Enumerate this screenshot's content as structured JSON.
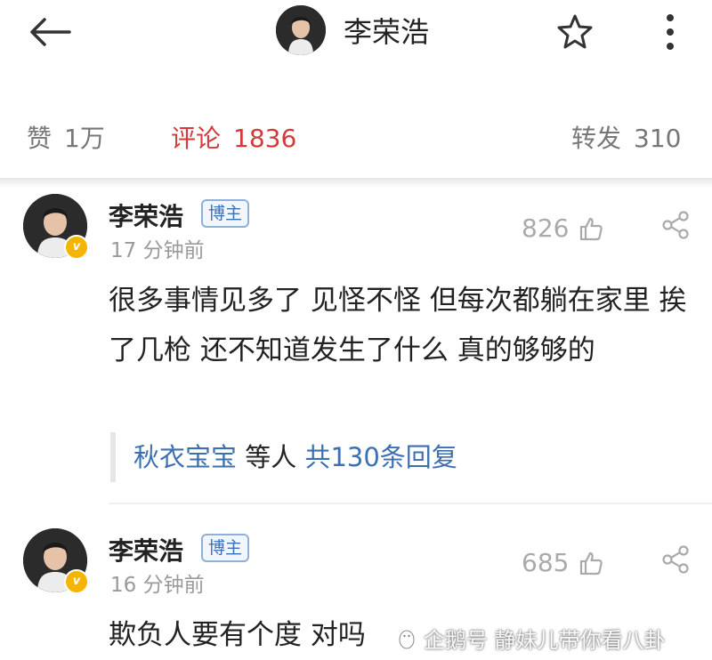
{
  "header": {
    "back_icon": "arrow-left-icon",
    "title": "李荣浩",
    "star_icon": "star-outline-icon",
    "more_icon": "more-vertical-icon"
  },
  "stats": {
    "likes_label": "赞",
    "likes_count": "1万",
    "comments_label": "评论",
    "comments_count": "1836",
    "reposts_label": "转发",
    "reposts_count": "310",
    "active_color": "#d43a3a"
  },
  "comments": [
    {
      "name": "李荣浩",
      "tag": "博主",
      "time": "17 分钟前",
      "likes": "826",
      "content": "很多事情见多了 见怪不怪 但每次都躺在家里 挨了几枪 还不知道发生了什么 真的够够的",
      "replies": {
        "user": "秋衣宝宝",
        "mid": " 等人 ",
        "total": "共130条回复"
      }
    },
    {
      "name": "李荣浩",
      "tag": "博主",
      "time": "16 分钟前",
      "likes": "685",
      "content": "欺负人要有个度 对吗"
    }
  ],
  "watermark": "企鹅号 静妹儿带你看八卦"
}
